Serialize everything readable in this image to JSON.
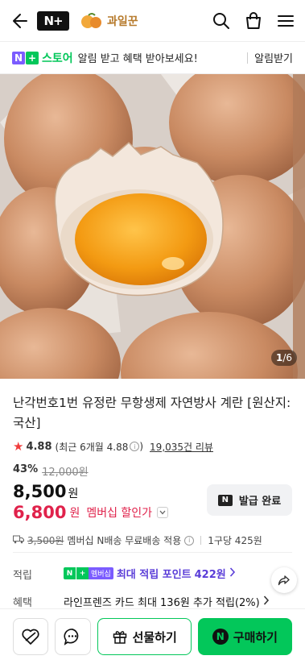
{
  "header": {
    "nplus_label": "N+",
    "brand_name": "과일꾼"
  },
  "banner": {
    "badge_label": "N",
    "store_name": "스토어",
    "message": "알림 받고 혜택 받아보세요!",
    "cta": "알림받기"
  },
  "gallery": {
    "current": "1",
    "total": "/6"
  },
  "product": {
    "title": "난각번호1번 유정란 무항생제 자연방사 계란 [원산지:국산]",
    "rating": "4.88",
    "rating_detail": "(최근 6개월 4.88",
    "rating_detail_end": ")",
    "review_count": "19,035건 리뷰",
    "discount_pct": "43%",
    "original_price": "12,000원",
    "price": "8,500",
    "price_unit": "원",
    "member_price": "6,800",
    "member_unit": "원",
    "member_label": "멤버십 할인가",
    "coupon_label": "발급 완료",
    "shipping_fee": "3,500원",
    "shipping_text": "멤버십 N배송 무료배송 적용",
    "per_unit": "1구당 425원"
  },
  "benefits": {
    "points_label": "적립",
    "points_badge": "멤버십",
    "points_text_prefix": "최대 적립 포인트",
    "points_value": "422원",
    "perks_label": "혜택",
    "perks_text": "라인프렌즈 카드 최대 136원 추가 적립(2%)"
  },
  "bottom": {
    "gift_label": "선물하기",
    "buy_label": "구매하기"
  },
  "colors": {
    "naver_green": "#03c75a",
    "member_red": "#e0224b",
    "membership_purple": "#7b5cff"
  }
}
